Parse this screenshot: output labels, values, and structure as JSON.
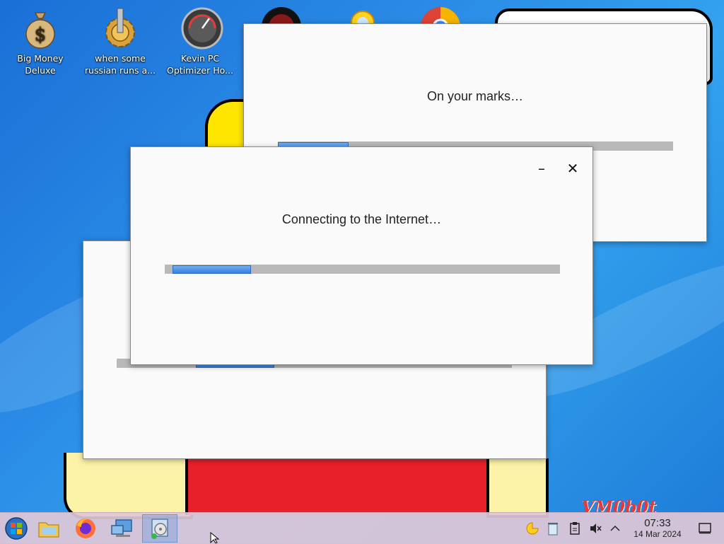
{
  "desktop": {
    "icons": [
      {
        "label": "Big Money Deluxe",
        "icon": "money-bag-icon"
      },
      {
        "label": "when some russian runs a...",
        "icon": "gear-icon"
      },
      {
        "label": "Kevin PC Optimizer Ho...",
        "icon": "speedometer-icon"
      },
      {
        "label": "",
        "icon": "red-circle-icon"
      },
      {
        "label": "",
        "icon": "sun-icon"
      },
      {
        "label": "",
        "icon": "chrome-icon"
      }
    ],
    "watermark": "VM0b0t"
  },
  "windows": {
    "back": {
      "message": "On your marks…",
      "progress": 0.18
    },
    "front": {
      "message": "Connecting to the Internet…",
      "progress": 0.2,
      "minimize": "–",
      "close": "✕"
    },
    "lower": {
      "message": "",
      "progress": 0.2
    }
  },
  "taskbar": {
    "start_icon": "start-orb-icon",
    "pinned": [
      "file-explorer-icon",
      "firefox-icon",
      "network-icon",
      "installer-icon"
    ],
    "tray": [
      "pac-moon-icon",
      "recycle-icon",
      "clipboard-icon",
      "volume-muted-icon",
      "chevron-up-icon"
    ],
    "clock_time": "07:33",
    "clock_date": "14 Mar 2024",
    "show_desktop_icon": "show-desktop-icon"
  }
}
